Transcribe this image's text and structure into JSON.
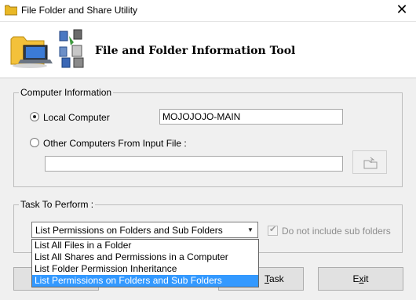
{
  "window": {
    "title": "File Folder and Share Utility",
    "close_glyph": "✕"
  },
  "banner": {
    "title": "File and Folder Information Tool"
  },
  "computer_info": {
    "legend": "Computer Information",
    "local_label": "Local Computer",
    "local_value": "MOJOJOJO-MAIN",
    "other_label": "Other Computers From Input File :",
    "input_file_value": ""
  },
  "task": {
    "legend": "Task To Perform :",
    "selected": "List Permissions on Folders and Sub Folders",
    "options": [
      "List All Files in a Folder",
      "List All Shares and Permissions in a Computer",
      "List Folder Permission Inheritance",
      "List Permissions on Folders and Sub Folders"
    ],
    "checkbox_label": "Do not include sub folders",
    "checkbox_checked": true
  },
  "buttons": {
    "task_label": "Task",
    "task_mnemonic": "T",
    "exit_label": "Exit",
    "exit_mnemonic": "x"
  },
  "colors": {
    "selection": "#3399ff",
    "title_bg": "#ffffff",
    "dialog_bg": "#f0f0f0"
  }
}
